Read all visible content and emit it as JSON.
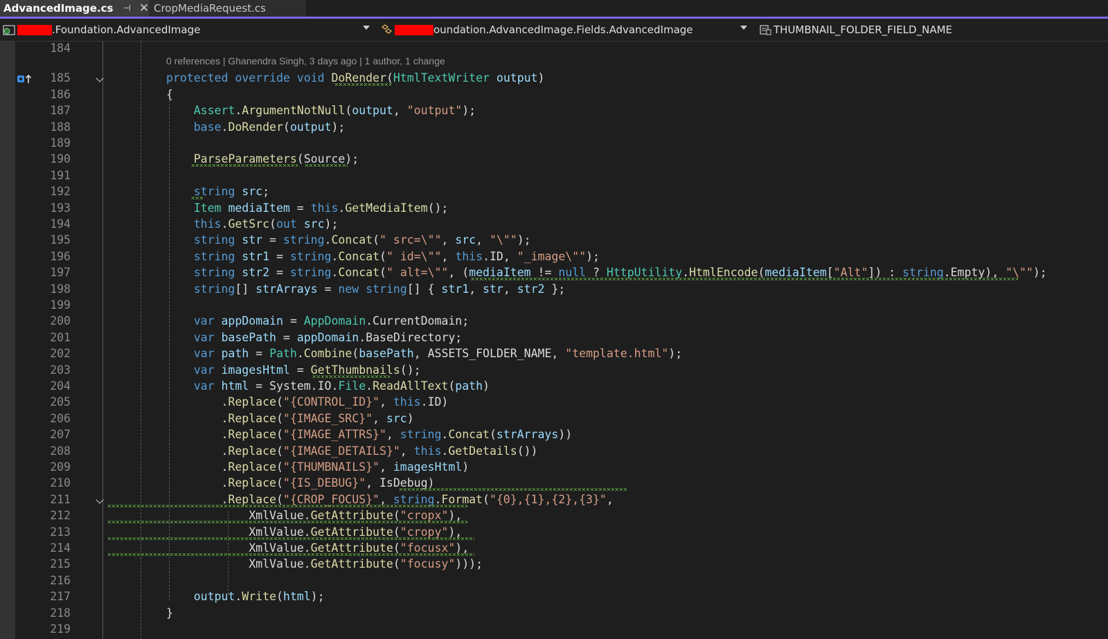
{
  "tabs": [
    {
      "label": "AdvancedImage.cs",
      "active": true,
      "pinned_icon": "pin-icon",
      "close_icon": "close-icon"
    },
    {
      "label": "CropMediaRequest.cs",
      "active": false
    }
  ],
  "navbar": {
    "project": ".Foundation.AdvancedImage",
    "type": "oundation.AdvancedImage.Fields.AdvancedImage",
    "type_prefix": "F",
    "member": "THUMBNAIL_FOLDER_FIELD_NAME"
  },
  "codelens": "0 references | Ghanendra Singh, 3 days ago | 1 author, 1 change",
  "colors": {
    "keyword": "#569cd6",
    "type": "#4ec9b0",
    "method": "#dcdcaa",
    "string": "#d69d85",
    "param": "#9cdcfe",
    "text": "#dcdcdc",
    "accent": "#7b68ee",
    "squiggle": "#6fbf4a"
  },
  "lines": [
    {
      "n": "184",
      "tokens": []
    },
    {
      "n": "185",
      "tokens": [
        [
          "k",
          "protected"
        ],
        [
          "t",
          " "
        ],
        [
          "k",
          "override"
        ],
        [
          "t",
          " "
        ],
        [
          "k",
          "void"
        ],
        [
          "t",
          " "
        ],
        [
          "m",
          "DoRender"
        ],
        [
          "t",
          "("
        ],
        [
          "y",
          "HtmlTextWriter"
        ],
        [
          "t",
          " "
        ],
        [
          "p",
          "output"
        ],
        [
          "t",
          ")"
        ]
      ]
    },
    {
      "n": "186",
      "tokens": [
        [
          "t",
          "{"
        ]
      ]
    },
    {
      "n": "187",
      "tokens": [
        [
          "t",
          "    "
        ],
        [
          "y",
          "Assert"
        ],
        [
          "t",
          "."
        ],
        [
          "m",
          "ArgumentNotNull"
        ],
        [
          "t",
          "("
        ],
        [
          "p",
          "output"
        ],
        [
          "t",
          ", "
        ],
        [
          "s",
          "\"output\""
        ],
        [
          "t",
          ");"
        ]
      ]
    },
    {
      "n": "188",
      "tokens": [
        [
          "t",
          "    "
        ],
        [
          "k",
          "base"
        ],
        [
          "t",
          "."
        ],
        [
          "m",
          "DoRender"
        ],
        [
          "t",
          "("
        ],
        [
          "p",
          "output"
        ],
        [
          "t",
          ");"
        ]
      ]
    },
    {
      "n": "189",
      "tokens": []
    },
    {
      "n": "190",
      "tokens": [
        [
          "t",
          "    "
        ],
        [
          "m",
          "ParseParameters"
        ],
        [
          "t",
          "(Source);"
        ]
      ]
    },
    {
      "n": "191",
      "tokens": []
    },
    {
      "n": "192",
      "tokens": [
        [
          "t",
          "    "
        ],
        [
          "k",
          "string"
        ],
        [
          "t",
          " "
        ],
        [
          "p",
          "src"
        ],
        [
          "t",
          ";"
        ]
      ]
    },
    {
      "n": "193",
      "tokens": [
        [
          "t",
          "    "
        ],
        [
          "y",
          "Item"
        ],
        [
          "t",
          " "
        ],
        [
          "p",
          "mediaItem"
        ],
        [
          "t",
          " = "
        ],
        [
          "k",
          "this"
        ],
        [
          "t",
          "."
        ],
        [
          "m",
          "GetMediaItem"
        ],
        [
          "t",
          "();"
        ]
      ]
    },
    {
      "n": "194",
      "tokens": [
        [
          "t",
          "    "
        ],
        [
          "k",
          "this"
        ],
        [
          "t",
          "."
        ],
        [
          "m",
          "GetSrc"
        ],
        [
          "t",
          "("
        ],
        [
          "k",
          "out"
        ],
        [
          "t",
          " "
        ],
        [
          "p",
          "src"
        ],
        [
          "t",
          ");"
        ]
      ]
    },
    {
      "n": "195",
      "tokens": [
        [
          "t",
          "    "
        ],
        [
          "k",
          "string"
        ],
        [
          "t",
          " "
        ],
        [
          "p",
          "str"
        ],
        [
          "t",
          " = "
        ],
        [
          "k",
          "string"
        ],
        [
          "t",
          "."
        ],
        [
          "m",
          "Concat"
        ],
        [
          "t",
          "("
        ],
        [
          "s",
          "\" src=\\\"\""
        ],
        [
          "t",
          ", "
        ],
        [
          "p",
          "src"
        ],
        [
          "t",
          ", "
        ],
        [
          "s",
          "\"\\\"\""
        ],
        [
          "t",
          ");"
        ]
      ]
    },
    {
      "n": "196",
      "tokens": [
        [
          "t",
          "    "
        ],
        [
          "k",
          "string"
        ],
        [
          "t",
          " "
        ],
        [
          "p",
          "str1"
        ],
        [
          "t",
          " = "
        ],
        [
          "k",
          "string"
        ],
        [
          "t",
          "."
        ],
        [
          "m",
          "Concat"
        ],
        [
          "t",
          "("
        ],
        [
          "s",
          "\" id=\\\"\""
        ],
        [
          "t",
          ", "
        ],
        [
          "k",
          "this"
        ],
        [
          "t",
          ".ID, "
        ],
        [
          "s",
          "\"_image\\\"\""
        ],
        [
          "t",
          ");"
        ]
      ]
    },
    {
      "n": "197",
      "tokens": [
        [
          "t",
          "    "
        ],
        [
          "k",
          "string"
        ],
        [
          "t",
          " "
        ],
        [
          "p",
          "str2"
        ],
        [
          "t",
          " = "
        ],
        [
          "k",
          "string"
        ],
        [
          "t",
          "."
        ],
        [
          "m",
          "Concat"
        ],
        [
          "t",
          "("
        ],
        [
          "s",
          "\" alt=\\\"\""
        ],
        [
          "t",
          ", ("
        ],
        [
          "p",
          "mediaItem"
        ],
        [
          "t",
          " != "
        ],
        [
          "k",
          "null"
        ],
        [
          "t",
          " ? "
        ],
        [
          "y",
          "HttpUtility"
        ],
        [
          "t",
          "."
        ],
        [
          "m",
          "HtmlEncode"
        ],
        [
          "t",
          "("
        ],
        [
          "p",
          "mediaItem"
        ],
        [
          "t",
          "["
        ],
        [
          "s",
          "\"Alt\""
        ],
        [
          "t",
          "]) : "
        ],
        [
          "k",
          "string"
        ],
        [
          "t",
          ".Empty), "
        ],
        [
          "s",
          "\"\\\"\""
        ],
        [
          "t",
          ");"
        ]
      ]
    },
    {
      "n": "198",
      "tokens": [
        [
          "t",
          "    "
        ],
        [
          "k",
          "string"
        ],
        [
          "t",
          "[] "
        ],
        [
          "p",
          "strArrays"
        ],
        [
          "t",
          " = "
        ],
        [
          "k",
          "new"
        ],
        [
          "t",
          " "
        ],
        [
          "k",
          "string"
        ],
        [
          "t",
          "[] { "
        ],
        [
          "p",
          "str1"
        ],
        [
          "t",
          ", "
        ],
        [
          "p",
          "str"
        ],
        [
          "t",
          ", "
        ],
        [
          "p",
          "str2"
        ],
        [
          "t",
          " };"
        ]
      ]
    },
    {
      "n": "199",
      "tokens": []
    },
    {
      "n": "200",
      "tokens": [
        [
          "t",
          "    "
        ],
        [
          "k",
          "var"
        ],
        [
          "t",
          " "
        ],
        [
          "p",
          "appDomain"
        ],
        [
          "t",
          " = "
        ],
        [
          "y",
          "AppDomain"
        ],
        [
          "t",
          ".CurrentDomain;"
        ]
      ]
    },
    {
      "n": "201",
      "tokens": [
        [
          "t",
          "    "
        ],
        [
          "k",
          "var"
        ],
        [
          "t",
          " "
        ],
        [
          "p",
          "basePath"
        ],
        [
          "t",
          " = "
        ],
        [
          "p",
          "appDomain"
        ],
        [
          "t",
          ".BaseDirectory;"
        ]
      ]
    },
    {
      "n": "202",
      "tokens": [
        [
          "t",
          "    "
        ],
        [
          "k",
          "var"
        ],
        [
          "t",
          " "
        ],
        [
          "p",
          "path"
        ],
        [
          "t",
          " = "
        ],
        [
          "y",
          "Path"
        ],
        [
          "t",
          "."
        ],
        [
          "m",
          "Combine"
        ],
        [
          "t",
          "("
        ],
        [
          "p",
          "basePath"
        ],
        [
          "t",
          ", ASSETS_FOLDER_NAME, "
        ],
        [
          "s",
          "\"template.html\""
        ],
        [
          "t",
          ");"
        ]
      ]
    },
    {
      "n": "203",
      "tokens": [
        [
          "t",
          "    "
        ],
        [
          "k",
          "var"
        ],
        [
          "t",
          " "
        ],
        [
          "p",
          "imagesHtml"
        ],
        [
          "t",
          " = "
        ],
        [
          "m",
          "GetThumbnails"
        ],
        [
          "t",
          "();"
        ]
      ]
    },
    {
      "n": "204",
      "tokens": [
        [
          "t",
          "    "
        ],
        [
          "k",
          "var"
        ],
        [
          "t",
          " "
        ],
        [
          "p",
          "html"
        ],
        [
          "t",
          " = System.IO."
        ],
        [
          "y",
          "File"
        ],
        [
          "t",
          "."
        ],
        [
          "m",
          "ReadAllText"
        ],
        [
          "t",
          "("
        ],
        [
          "p",
          "path"
        ],
        [
          "t",
          ")"
        ]
      ]
    },
    {
      "n": "205",
      "tokens": [
        [
          "t",
          "        ."
        ],
        [
          "m",
          "Replace"
        ],
        [
          "t",
          "("
        ],
        [
          "s",
          "\"{CONTROL_ID}\""
        ],
        [
          "t",
          ", "
        ],
        [
          "k",
          "this"
        ],
        [
          "t",
          ".ID)"
        ]
      ]
    },
    {
      "n": "206",
      "tokens": [
        [
          "t",
          "        ."
        ],
        [
          "m",
          "Replace"
        ],
        [
          "t",
          "("
        ],
        [
          "s",
          "\"{IMAGE_SRC}\""
        ],
        [
          "t",
          ", "
        ],
        [
          "p",
          "src"
        ],
        [
          "t",
          ")"
        ]
      ]
    },
    {
      "n": "207",
      "tokens": [
        [
          "t",
          "        ."
        ],
        [
          "m",
          "Replace"
        ],
        [
          "t",
          "("
        ],
        [
          "s",
          "\"{IMAGE_ATTRS}\""
        ],
        [
          "t",
          ", "
        ],
        [
          "k",
          "string"
        ],
        [
          "t",
          "."
        ],
        [
          "m",
          "Concat"
        ],
        [
          "t",
          "("
        ],
        [
          "p",
          "strArrays"
        ],
        [
          "t",
          "))"
        ]
      ]
    },
    {
      "n": "208",
      "tokens": [
        [
          "t",
          "        ."
        ],
        [
          "m",
          "Replace"
        ],
        [
          "t",
          "("
        ],
        [
          "s",
          "\"{IMAGE_DETAILS}\""
        ],
        [
          "t",
          ", "
        ],
        [
          "k",
          "this"
        ],
        [
          "t",
          "."
        ],
        [
          "m",
          "GetDetails"
        ],
        [
          "t",
          "())"
        ]
      ]
    },
    {
      "n": "209",
      "tokens": [
        [
          "t",
          "        ."
        ],
        [
          "m",
          "Replace"
        ],
        [
          "t",
          "("
        ],
        [
          "s",
          "\"{THUMBNAILS}\""
        ],
        [
          "t",
          ", "
        ],
        [
          "p",
          "imagesHtml"
        ],
        [
          "t",
          ")"
        ]
      ]
    },
    {
      "n": "210",
      "tokens": [
        [
          "t",
          "        ."
        ],
        [
          "m",
          "Replace"
        ],
        [
          "t",
          "("
        ],
        [
          "s",
          "\"{IS_DEBUG}\""
        ],
        [
          "t",
          ", IsDebug)"
        ]
      ]
    },
    {
      "n": "211",
      "tokens": [
        [
          "t",
          "        ."
        ],
        [
          "m",
          "Replace"
        ],
        [
          "t",
          "("
        ],
        [
          "s",
          "\"{CROP_FOCUS}\""
        ],
        [
          "t",
          ", "
        ],
        [
          "k",
          "string"
        ],
        [
          "t",
          "."
        ],
        [
          "m",
          "Format"
        ],
        [
          "t",
          "("
        ],
        [
          "s",
          "\"{0},{1},{2},{3}\""
        ],
        [
          "t",
          ","
        ]
      ]
    },
    {
      "n": "212",
      "tokens": [
        [
          "t",
          "            XmlValue."
        ],
        [
          "m",
          "GetAttribute"
        ],
        [
          "t",
          "("
        ],
        [
          "s",
          "\"cropx\""
        ],
        [
          "t",
          "),"
        ]
      ]
    },
    {
      "n": "213",
      "tokens": [
        [
          "t",
          "            XmlValue."
        ],
        [
          "m",
          "GetAttribute"
        ],
        [
          "t",
          "("
        ],
        [
          "s",
          "\"cropy\""
        ],
        [
          "t",
          "),"
        ]
      ]
    },
    {
      "n": "214",
      "tokens": [
        [
          "t",
          "            XmlValue."
        ],
        [
          "m",
          "GetAttribute"
        ],
        [
          "t",
          "("
        ],
        [
          "s",
          "\"focusx\""
        ],
        [
          "t",
          "),"
        ]
      ]
    },
    {
      "n": "215",
      "tokens": [
        [
          "t",
          "            XmlValue."
        ],
        [
          "m",
          "GetAttribute"
        ],
        [
          "t",
          "("
        ],
        [
          "s",
          "\"focusy\""
        ],
        [
          "t",
          ")));"
        ]
      ]
    },
    {
      "n": "216",
      "tokens": []
    },
    {
      "n": "217",
      "tokens": [
        [
          "t",
          "    "
        ],
        [
          "p",
          "output"
        ],
        [
          "t",
          "."
        ],
        [
          "m",
          "Write"
        ],
        [
          "t",
          "("
        ],
        [
          "p",
          "html"
        ],
        [
          "t",
          ");"
        ]
      ]
    },
    {
      "n": "218",
      "tokens": [
        [
          "t",
          "}"
        ]
      ]
    },
    {
      "n": "219",
      "tokens": []
    }
  ]
}
